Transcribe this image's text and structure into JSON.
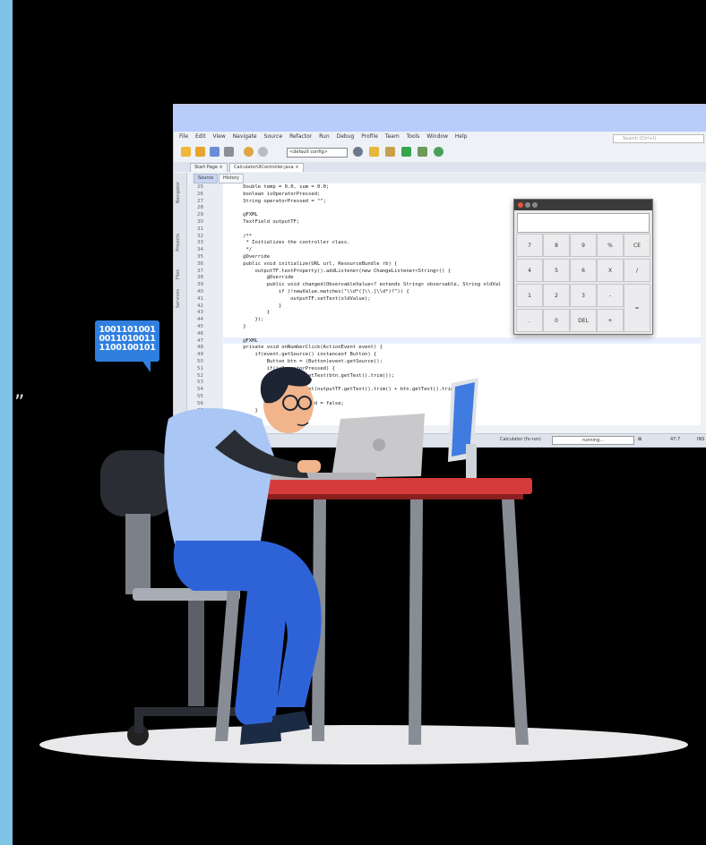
{
  "ide": {
    "menu": [
      "File",
      "Edit",
      "View",
      "Navigate",
      "Source",
      "Refactor",
      "Run",
      "Debug",
      "Profile",
      "Team",
      "Tools",
      "Window",
      "Help"
    ],
    "search_placeholder": "Search (Ctrl+I)",
    "config": "<default config>",
    "tabs": [
      "Start Page ×",
      "CalculatorUIController.java ×"
    ],
    "subtabs": [
      "Source",
      "History"
    ],
    "side_labels": [
      "Navigator",
      "Projects",
      "Files",
      "Services"
    ],
    "line_numbers": [
      "25",
      "26",
      "27",
      "28",
      "29",
      "30",
      "31",
      "32",
      "33",
      "34",
      "35",
      "36",
      "37",
      "38",
      "39",
      "40",
      "41",
      "42",
      "43",
      "44",
      "45",
      "46",
      "47",
      "48",
      "49",
      "50",
      "51",
      "52",
      "53",
      "54",
      "55",
      "56",
      "57",
      "58"
    ],
    "code": [
      "    Double temp = 0.0, sum = 0.0;",
      "    boolean isOperatorPressed;",
      "    String operatorPressed = \"\";",
      "",
      "    @FXML",
      "    TextField outputTF;",
      "",
      "    /**",
      "     * Initializes the controller class.",
      "     */",
      "    @Override",
      "    public void initialize(URL url, ResourceBundle rb) {",
      "        outputTF.textProperty().addListener(new ChangeListener<String>() {",
      "            @Override",
      "            public void changed(ObservableValue<? extends String> observable, String oldVal",
      "                if (!newValue.matches(\"\\\\d*([\\\\.]\\\\d*)?\")) {",
      "                    outputTF.setText(oldValue);",
      "                }",
      "            }",
      "        });",
      "    }",
      "",
      "    @FXML",
      "    private void onNumberClick(ActionEvent event) {",
      "        if(event.getSource() instanceof Button) {",
      "            Button btn = (Button)event.getSource();",
      "            if(isOperatorPressed) {",
      "                outputTF.setText(btn.getText().trim());",
      "            }",
      "            outputTF.setText(outputTF.getText().trim() + btn.getText().trim());",
      "            }",
      "            isOperatorPressed = false;",
      "        }",
      ""
    ],
    "status_app": "Calculator (fx-run)",
    "status_state": "running...",
    "status_pos": "47:7",
    "status_mode": "INS"
  },
  "calculator": {
    "keys": [
      "7",
      "8",
      "9",
      "%",
      "CE",
      "4",
      "5",
      "6",
      "X",
      "/",
      "1",
      "2",
      "3",
      "-",
      "=",
      ".",
      "0",
      "DEL",
      "+"
    ]
  },
  "bubble": {
    "lines": [
      "1001101001",
      "0011010011",
      "1100100101"
    ]
  },
  "stray_glyph": "”",
  "colors": {
    "left_strip": "#7fc4e6",
    "shirt": "#a9c6f5",
    "pants": "#2e63d8",
    "desk_top": "#d63b3b",
    "laptop": "#c9c9cc",
    "monitor_screen": "#3f7be0",
    "floor": "#e9e9ec"
  }
}
